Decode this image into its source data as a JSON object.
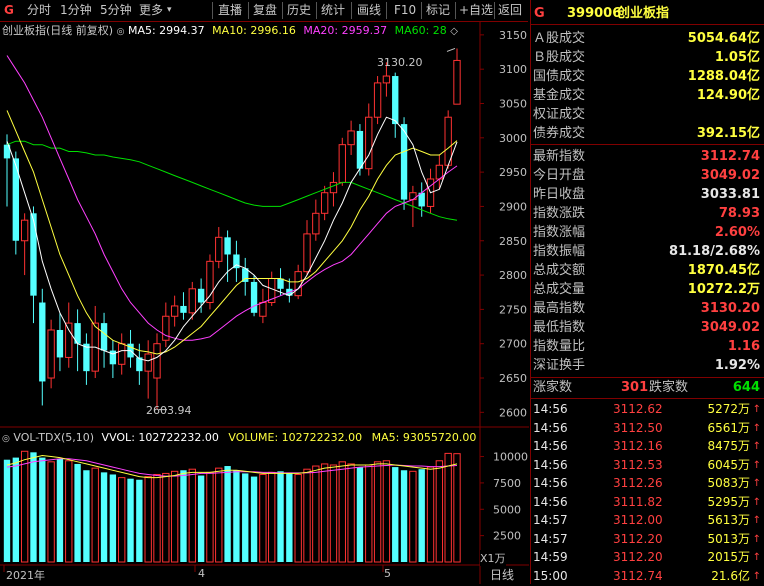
{
  "toolbar": {
    "g_label": "G",
    "buttons": [
      "分时",
      "1分钟",
      "5分钟",
      "更多",
      "直播",
      "复盘",
      "历史",
      "统计",
      "画线",
      "F10",
      "标记",
      "+自选",
      "返回"
    ]
  },
  "main_legend": {
    "title": "创业板指(日线 前复权)",
    "ma5": "MA5: 2994.37",
    "ma10": "MA10: 2996.16",
    "ma20": "MA20: 2959.37",
    "ma60": "MA60: 28",
    "colors": {
      "ma5": "#ffffff",
      "ma10": "#ffff00",
      "ma20": "#ff40ff",
      "ma60": "#00e000"
    }
  },
  "volume_legend": {
    "name": "VOL-TDX(5,10)",
    "vvol": "VVOL: 102722232.00",
    "volume": "VOLUME: 102722232.00",
    "ma5": "MA5: 93055720.00"
  },
  "chart_data": [
    {
      "type": "candlestick",
      "title": "创业板指(日线 前复权)",
      "y_ticks": [
        "3150",
        "3100",
        "3050",
        "3000",
        "2950",
        "2900",
        "2850",
        "2800",
        "2750",
        "2700",
        "2650",
        "2600"
      ],
      "ylim": [
        2583,
        3160
      ],
      "annotations": {
        "high": "3130.20",
        "low": "2603.94"
      },
      "candles": [
        {
          "o": 2990,
          "c": 2970,
          "h": 3005,
          "l": 2900
        },
        {
          "o": 2970,
          "c": 2850,
          "h": 2980,
          "l": 2830
        },
        {
          "o": 2850,
          "c": 2880,
          "h": 2890,
          "l": 2800
        },
        {
          "o": 2890,
          "c": 2770,
          "h": 2900,
          "l": 2730
        },
        {
          "o": 2760,
          "c": 2645,
          "h": 2780,
          "l": 2610
        },
        {
          "o": 2650,
          "c": 2720,
          "h": 2735,
          "l": 2635
        },
        {
          "o": 2720,
          "c": 2680,
          "h": 2745,
          "l": 2660
        },
        {
          "o": 2680,
          "c": 2730,
          "h": 2760,
          "l": 2665
        },
        {
          "o": 2730,
          "c": 2700,
          "h": 2750,
          "l": 2660
        },
        {
          "o": 2700,
          "c": 2660,
          "h": 2715,
          "l": 2640
        },
        {
          "o": 2660,
          "c": 2730,
          "h": 2755,
          "l": 2650
        },
        {
          "o": 2730,
          "c": 2690,
          "h": 2745,
          "l": 2665
        },
        {
          "o": 2690,
          "c": 2670,
          "h": 2705,
          "l": 2650
        },
        {
          "o": 2670,
          "c": 2700,
          "h": 2715,
          "l": 2655
        },
        {
          "o": 2700,
          "c": 2680,
          "h": 2720,
          "l": 2665
        },
        {
          "o": 2680,
          "c": 2660,
          "h": 2700,
          "l": 2640
        },
        {
          "o": 2660,
          "c": 2685,
          "h": 2705,
          "l": 2620
        },
        {
          "o": 2650,
          "c": 2700,
          "h": 2715,
          "l": 2604
        },
        {
          "o": 2705,
          "c": 2740,
          "h": 2760,
          "l": 2695
        },
        {
          "o": 2740,
          "c": 2755,
          "h": 2770,
          "l": 2725
        },
        {
          "o": 2755,
          "c": 2745,
          "h": 2775,
          "l": 2735
        },
        {
          "o": 2745,
          "c": 2780,
          "h": 2790,
          "l": 2735
        },
        {
          "o": 2780,
          "c": 2760,
          "h": 2795,
          "l": 2745
        },
        {
          "o": 2760,
          "c": 2820,
          "h": 2830,
          "l": 2750
        },
        {
          "o": 2820,
          "c": 2855,
          "h": 2870,
          "l": 2810
        },
        {
          "o": 2855,
          "c": 2830,
          "h": 2865,
          "l": 2790
        },
        {
          "o": 2830,
          "c": 2810,
          "h": 2850,
          "l": 2790
        },
        {
          "o": 2810,
          "c": 2790,
          "h": 2825,
          "l": 2770
        },
        {
          "o": 2790,
          "c": 2745,
          "h": 2800,
          "l": 2740
        },
        {
          "o": 2740,
          "c": 2760,
          "h": 2780,
          "l": 2730
        },
        {
          "o": 2760,
          "c": 2795,
          "h": 2805,
          "l": 2755
        },
        {
          "o": 2795,
          "c": 2780,
          "h": 2810,
          "l": 2770
        },
        {
          "o": 2780,
          "c": 2770,
          "h": 2795,
          "l": 2760
        },
        {
          "o": 2770,
          "c": 2805,
          "h": 2815,
          "l": 2765
        },
        {
          "o": 2805,
          "c": 2860,
          "h": 2880,
          "l": 2800
        },
        {
          "o": 2860,
          "c": 2890,
          "h": 2910,
          "l": 2850
        },
        {
          "o": 2890,
          "c": 2920,
          "h": 2930,
          "l": 2880
        },
        {
          "o": 2920,
          "c": 2935,
          "h": 2950,
          "l": 2900
        },
        {
          "o": 2935,
          "c": 2990,
          "h": 3000,
          "l": 2930
        },
        {
          "o": 2990,
          "c": 3010,
          "h": 3025,
          "l": 2975
        },
        {
          "o": 3010,
          "c": 2955,
          "h": 3020,
          "l": 2945
        },
        {
          "o": 2955,
          "c": 3030,
          "h": 3050,
          "l": 2945
        },
        {
          "o": 3030,
          "c": 3080,
          "h": 3090,
          "l": 3020
        },
        {
          "o": 3080,
          "c": 3090,
          "h": 3110,
          "l": 3060
        },
        {
          "o": 3090,
          "c": 3020,
          "h": 3095,
          "l": 3000
        },
        {
          "o": 3020,
          "c": 2910,
          "h": 3030,
          "l": 2895
        },
        {
          "o": 2910,
          "c": 2920,
          "h": 2930,
          "l": 2870
        },
        {
          "o": 2920,
          "c": 2900,
          "h": 2935,
          "l": 2885
        },
        {
          "o": 2900,
          "c": 2940,
          "h": 2955,
          "l": 2890
        },
        {
          "o": 2940,
          "c": 2960,
          "h": 2975,
          "l": 2925
        },
        {
          "o": 2960,
          "c": 3030,
          "h": 3040,
          "l": 2955
        },
        {
          "o": 3049.02,
          "c": 3112.74,
          "h": 3130.2,
          "l": 3049.02
        }
      ],
      "ma5": [
        2995,
        2960,
        2920,
        2880,
        2820,
        2780,
        2745,
        2720,
        2700,
        2695,
        2695,
        2690,
        2685,
        2690,
        2690,
        2678,
        2675,
        2680,
        2690,
        2705,
        2725,
        2740,
        2755,
        2770,
        2790,
        2805,
        2815,
        2810,
        2800,
        2785,
        2780,
        2775,
        2770,
        2780,
        2800,
        2825,
        2850,
        2880,
        2905,
        2935,
        2955,
        2975,
        3005,
        3030,
        3025,
        3010,
        2990,
        2950,
        2920,
        2925,
        2960,
        2994
      ],
      "ma10": [
        3040,
        3010,
        2980,
        2950,
        2910,
        2870,
        2830,
        2800,
        2770,
        2745,
        2725,
        2715,
        2705,
        2700,
        2695,
        2690,
        2688,
        2685,
        2688,
        2695,
        2705,
        2715,
        2725,
        2740,
        2755,
        2770,
        2785,
        2795,
        2795,
        2795,
        2795,
        2795,
        2790,
        2790,
        2795,
        2805,
        2820,
        2835,
        2850,
        2870,
        2895,
        2915,
        2940,
        2960,
        2975,
        2980,
        2985,
        2980,
        2975,
        2975,
        2985,
        2996
      ],
      "ma20": [
        3120,
        3100,
        3080,
        3055,
        3030,
        3000,
        2970,
        2940,
        2910,
        2885,
        2860,
        2830,
        2805,
        2780,
        2760,
        2745,
        2730,
        2720,
        2712,
        2708,
        2705,
        2705,
        2707,
        2710,
        2720,
        2730,
        2740,
        2748,
        2755,
        2760,
        2765,
        2770,
        2775,
        2780,
        2790,
        2800,
        2808,
        2815,
        2820,
        2830,
        2845,
        2860,
        2875,
        2890,
        2900,
        2905,
        2910,
        2920,
        2930,
        2940,
        2950,
        2959
      ],
      "ma60": [
        2990,
        2995,
        2995,
        2990,
        2990,
        2985,
        2985,
        2980,
        2980,
        2978,
        2975,
        2975,
        2972,
        2970,
        2968,
        2965,
        2960,
        2955,
        2950,
        2945,
        2940,
        2935,
        2930,
        2925,
        2920,
        2915,
        2910,
        2905,
        2902,
        2900,
        2900,
        2900,
        2905,
        2910,
        2915,
        2920,
        2925,
        2930,
        2935,
        2935,
        2930,
        2925,
        2920,
        2915,
        2910,
        2905,
        2900,
        2895,
        2890,
        2885,
        2882,
        2880
      ]
    },
    {
      "type": "bar",
      "title": "VOL-TDX(5,10)",
      "unit": "X1万",
      "y_ticks": [
        "10000",
        "7500",
        "5000",
        "2500"
      ],
      "ylim": [
        0,
        11000
      ],
      "values": [
        9700,
        9900,
        10500,
        10400,
        9900,
        9500,
        9800,
        9600,
        9300,
        8700,
        8900,
        8500,
        8300,
        8000,
        7900,
        7800,
        8100,
        8300,
        8400,
        8600,
        8700,
        8800,
        8200,
        8500,
        8900,
        9100,
        8700,
        8400,
        8100,
        8300,
        8500,
        8600,
        8400,
        8300,
        8800,
        9100,
        9300,
        9200,
        9500,
        9300,
        9000,
        9200,
        9500,
        9600,
        9000,
        8700,
        8600,
        8800,
        9000,
        9600,
        10300,
        10272
      ],
      "ma5": [
        9200,
        9400,
        9700,
        9900,
        10100,
        10000,
        9900,
        9700,
        9500,
        9300,
        9100,
        8900,
        8700,
        8500,
        8300,
        8100,
        8000,
        8000,
        8100,
        8200,
        8400,
        8500,
        8500,
        8500,
        8600,
        8700,
        8700,
        8600,
        8500,
        8400,
        8400,
        8400,
        8400,
        8400,
        8500,
        8700,
        8900,
        9000,
        9100,
        9200,
        9200,
        9200,
        9300,
        9300,
        9200,
        9100,
        9000,
        8900,
        8800,
        8900,
        9100,
        9305
      ],
      "ma10": [
        9000,
        9100,
        9300,
        9500,
        9600,
        9700,
        9800,
        9800,
        9700,
        9600,
        9400,
        9200,
        9000,
        8800,
        8600,
        8400,
        8300,
        8200,
        8150,
        8150,
        8200,
        8300,
        8400,
        8400,
        8450,
        8500,
        8550,
        8550,
        8550,
        8500,
        8500,
        8450,
        8450,
        8450,
        8450,
        8500,
        8600,
        8700,
        8800,
        8900,
        9000,
        9050,
        9100,
        9150,
        9200,
        9150,
        9100,
        9100,
        9050,
        9050,
        9100,
        9150
      ]
    }
  ],
  "x_axis": {
    "labels": [
      "2021年",
      "4",
      "5"
    ],
    "period": "日线"
  },
  "panel": {
    "g": "G",
    "code": "399006",
    "name": "创业板指",
    "turnover_rows": [
      {
        "label": "Ａ股成交",
        "value": "5054.64亿"
      },
      {
        "label": "Ｂ股成交",
        "value": "1.05亿"
      },
      {
        "label": "国债成交",
        "value": "1288.04亿"
      },
      {
        "label": "基金成交",
        "value": "124.90亿"
      },
      {
        "label": "权证成交",
        "value": ""
      },
      {
        "label": "债券成交",
        "value": "392.15亿"
      }
    ],
    "stat_rows": [
      {
        "label": "最新指数",
        "value": "3112.74",
        "color": "red"
      },
      {
        "label": "今日开盘",
        "value": "3049.02",
        "color": "red"
      },
      {
        "label": "昨日收盘",
        "value": "3033.81",
        "color": "wht"
      },
      {
        "label": "指数涨跌",
        "value": "78.93",
        "color": "red"
      },
      {
        "label": "指数涨幅",
        "value": "2.60%",
        "color": "red"
      },
      {
        "label": "指数振幅",
        "value": "81.18/2.68%",
        "color": "wht"
      },
      {
        "label": "总成交额",
        "value": "1870.45亿",
        "color": "yel"
      },
      {
        "label": "总成交量",
        "value": "10272.2万",
        "color": "yel"
      },
      {
        "label": "最高指数",
        "value": "3130.20",
        "color": "red"
      },
      {
        "label": "最低指数",
        "value": "3049.02",
        "color": "red"
      },
      {
        "label": "指数量比",
        "value": "1.16",
        "color": "red"
      },
      {
        "label": "深证换手",
        "value": "1.92%",
        "color": "wht"
      }
    ],
    "breadth": {
      "up_label": "涨家数",
      "up": "301",
      "down_label": "跌家数",
      "down": "644"
    },
    "ticks": [
      {
        "time": "14:56",
        "price": "3112.62",
        "vol": "5272万"
      },
      {
        "time": "14:56",
        "price": "3112.50",
        "vol": "6561万"
      },
      {
        "time": "14:56",
        "price": "3112.16",
        "vol": "8475万"
      },
      {
        "time": "14:56",
        "price": "3112.53",
        "vol": "6045万"
      },
      {
        "time": "14:56",
        "price": "3112.26",
        "vol": "5083万"
      },
      {
        "time": "14:56",
        "price": "3111.82",
        "vol": "5295万"
      },
      {
        "time": "14:57",
        "price": "3112.00",
        "vol": "5613万"
      },
      {
        "time": "14:57",
        "price": "3112.20",
        "vol": "5013万"
      },
      {
        "time": "14:59",
        "price": "3112.20",
        "vol": "2015万"
      },
      {
        "time": "15:00",
        "price": "3112.74",
        "vol": "21.6亿"
      }
    ]
  }
}
